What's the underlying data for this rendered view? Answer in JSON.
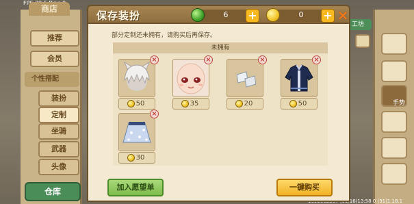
{
  "background": {
    "fps_text": "FPS 29.5  Ping 0",
    "shop_title": "商店",
    "menu": [
      {
        "label": "推荐"
      },
      {
        "label": "会员"
      }
    ],
    "menu_header": "个性搭配",
    "submenu": [
      {
        "label": "装扮"
      },
      {
        "label": "定制"
      },
      {
        "label": "坐骑"
      },
      {
        "label": "武器"
      },
      {
        "label": "头像"
      }
    ],
    "warehouse_label": "仓库",
    "right_tab_label": "工坊",
    "right_hand_label": "手势",
    "footer_text": "1653802387   (09/16)13:58 0   [91]1.18.1"
  },
  "dialog": {
    "title": "保存装扮",
    "currency": {
      "gems": "6",
      "coins": "0",
      "gem_icon": "green-gem-icon",
      "coin_icon": "gold-coin-icon",
      "plus_label": "+"
    },
    "close_label": "✕",
    "notice": "部分定制还未拥有，请购买后再保存。",
    "section_title": "未拥有",
    "items": [
      {
        "name": "white-fluffy-hair",
        "price": "50"
      },
      {
        "name": "face-with-red-eyes",
        "price": "35"
      },
      {
        "name": "white-gloves",
        "price": "20"
      },
      {
        "name": "navy-jacket",
        "price": "50"
      },
      {
        "name": "floral-skirt",
        "price": "30"
      }
    ],
    "remove_label": "×",
    "buttons": {
      "wishlist": "加入愿望单",
      "buy_all": "一键购买"
    },
    "colors": {
      "header": "#8f6f3f",
      "body": "#f4ead3",
      "wishlist_green": "#7fbb4c",
      "buy_gold": "#f0b226",
      "close_orange": "#ff7a1a"
    }
  }
}
